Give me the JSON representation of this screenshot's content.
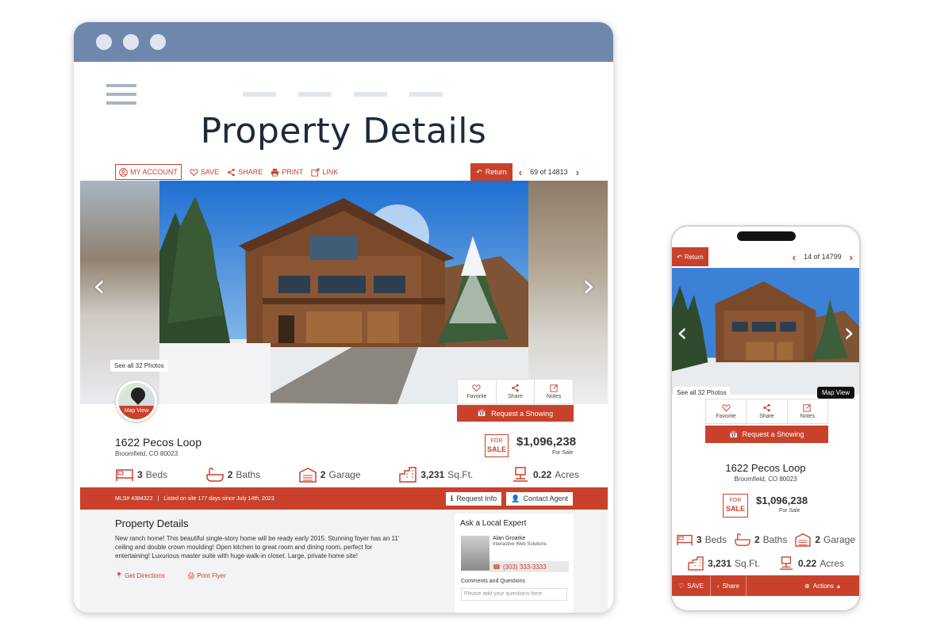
{
  "desktop": {
    "page_title": "Property Details",
    "toolbar": {
      "my_account": "MY ACCOUNT",
      "save": "SAVE",
      "share": "SHARE",
      "print": "PRINT",
      "link": "LINK",
      "return": "Return",
      "pager": "69 of 14813"
    },
    "gallery": {
      "see_all": "See all 32 Photos",
      "map_view": "Map View"
    },
    "actions": {
      "favorite": "Favorite",
      "share": "Share",
      "notes": "Notes",
      "request": "Request a Showing"
    },
    "listing": {
      "address": "1622 Pecos Loop",
      "city": "Broomfield, CO 80023",
      "for": "FOR",
      "sale": "SALE",
      "price": "$1,096,238",
      "status": "For Sale"
    },
    "features": [
      {
        "value": "3",
        "unit": "Beds"
      },
      {
        "value": "2",
        "unit": "Baths"
      },
      {
        "value": "2",
        "unit": "Garage"
      },
      {
        "value": "3,231",
        "unit": "Sq.Ft."
      },
      {
        "value": "0.22",
        "unit": "Acres"
      }
    ],
    "mls_bar": {
      "mls": "MLS# 4384322",
      "listed": "Listed on site 177 days since July 14th, 2023",
      "request_info": "Request Info",
      "contact_agent": "Contact Agent"
    },
    "details": {
      "title": "Property Details",
      "description": "New ranch home! This beautiful single-story home will be ready early 2015. Stunning foyer has an 11' ceiling and double crown moulding! Open kitchen to great room and dining room, perfect for entertaining! Luxurious master suite with huge walk-in closet. Large, private home site!",
      "get_directions": "Get Directions",
      "print_flyer": "Print Flyer"
    },
    "expert": {
      "title": "Ask a Local Expert",
      "name": "Alan Groarke",
      "company": "Interactive Web Solutions",
      "phone": "(303) 333-3333",
      "comments_label": "Comments and Questions",
      "comments_placeholder": "Please add your questions here"
    }
  },
  "mobile": {
    "return": "Return",
    "pager": "14 of 14799",
    "see_all": "See all 32 Photos",
    "map_view": "Map View",
    "favorite": "Favorite",
    "share": "Share",
    "notes": "Notes",
    "request": "Request a Showing",
    "address": "1622 Pecos Loop",
    "city": "Broomfield, CO 80023",
    "for": "FOR",
    "sale": "SALE",
    "price": "$1,096,238",
    "status": "For Sale",
    "features": [
      {
        "value": "3",
        "unit": "Beds"
      },
      {
        "value": "2",
        "unit": "Baths"
      },
      {
        "value": "2",
        "unit": "Garage"
      },
      {
        "value": "3,231",
        "unit": "Sq.Ft."
      },
      {
        "value": "0.22",
        "unit": "Acres"
      }
    ],
    "bottom": {
      "save": "SAVE",
      "share": "Share",
      "actions": "Actions"
    }
  },
  "colors": {
    "accent": "#c9412b",
    "browser_bar": "#6f87ad"
  },
  "icons": [
    "user-icon",
    "heart-icon",
    "share-icon",
    "print-icon",
    "link-icon",
    "return-icon",
    "chevron-left-icon",
    "chevron-right-icon",
    "map-pin-icon",
    "calendar-icon",
    "notes-icon",
    "bed-icon",
    "bath-icon",
    "garage-icon",
    "building-icon",
    "acres-icon",
    "phone-icon",
    "plus-circle-icon"
  ]
}
